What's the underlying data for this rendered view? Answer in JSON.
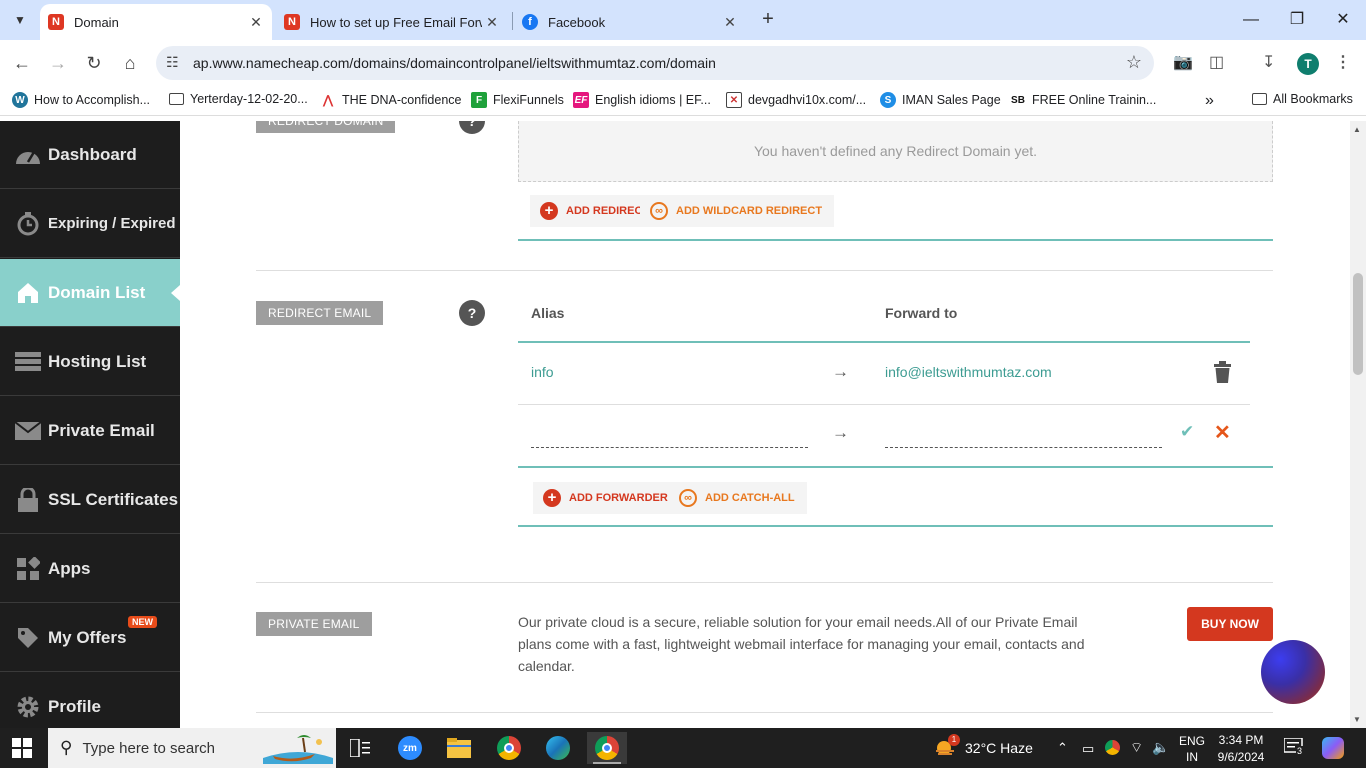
{
  "browser": {
    "tabs": [
      {
        "title": "Domain",
        "active": true
      },
      {
        "title": "How to set up Free Email Forwa",
        "active": false
      },
      {
        "title": "Facebook",
        "active": false
      }
    ],
    "url": "ap.www.namecheap.com/domains/domaincontrolpanel/ieltswithmumtaz.com/domain",
    "profile_initial": "T",
    "bookmarks": [
      "How to Accomplish...",
      "Yerterday-12-02-20...",
      "THE DNA-confidence",
      "FlexiFunnels",
      "English idioms | EF...",
      "devgadhvi10x.com/...",
      "IMAN Sales Page",
      "FREE Online Trainin..."
    ],
    "bookmarks_overflow": "»",
    "all_bookmarks": "All Bookmarks"
  },
  "sidebar": {
    "items": [
      {
        "label": "Dashboard",
        "icon": "speedometer-icon"
      },
      {
        "label": "Expiring / Expired",
        "icon": "timer-icon"
      },
      {
        "label": "Domain List",
        "icon": "home-icon",
        "active": true
      },
      {
        "label": "Hosting List",
        "icon": "server-icon"
      },
      {
        "label": "Private Email",
        "icon": "envelope-icon"
      },
      {
        "label": "SSL Certificates",
        "icon": "lock-icon"
      },
      {
        "label": "Apps",
        "icon": "apps-grid-icon"
      },
      {
        "label": "My Offers",
        "icon": "tag-icon",
        "badge": "NEW"
      },
      {
        "label": "Profile",
        "icon": "gear-icon"
      }
    ]
  },
  "redirect_domain": {
    "tag": "REDIRECT DOMAIN",
    "empty_message": "You haven't defined any Redirect Domain yet.",
    "add_redirect": "ADD REDIRECT",
    "add_wildcard": "ADD WILDCARD REDIRECT"
  },
  "redirect_email": {
    "tag": "REDIRECT EMAIL",
    "help": "?",
    "col_alias": "Alias",
    "col_forward": "Forward to",
    "rows": [
      {
        "alias": "info",
        "arrow": "→",
        "forward": "info@ieltswithmumtaz.com"
      }
    ],
    "new_row": {
      "alias_value": "",
      "forward_value": "",
      "arrow": "→"
    },
    "add_forwarder": "ADD FORWARDER",
    "add_catch_all": "ADD CATCH-ALL"
  },
  "private_email": {
    "tag": "PRIVATE EMAIL",
    "description": "Our private cloud is a secure, reliable solution for your email needs.All of our Private Email plans come with a fast, lightweight webmail interface for managing your email, contacts and calendar.",
    "buy_now": "BUY NOW"
  },
  "taskbar": {
    "search_placeholder": "Type here to search",
    "weather": "32°C  Haze",
    "weather_badge": "1",
    "lang_top": "ENG",
    "lang_bottom": "IN",
    "time": "3:34 PM",
    "date": "9/6/2024",
    "notifications": "3"
  },
  "colors": {
    "accent_teal": "#6fbfb8",
    "brand_red": "#d4381f",
    "sidebar_bg": "#1d1d1d"
  }
}
